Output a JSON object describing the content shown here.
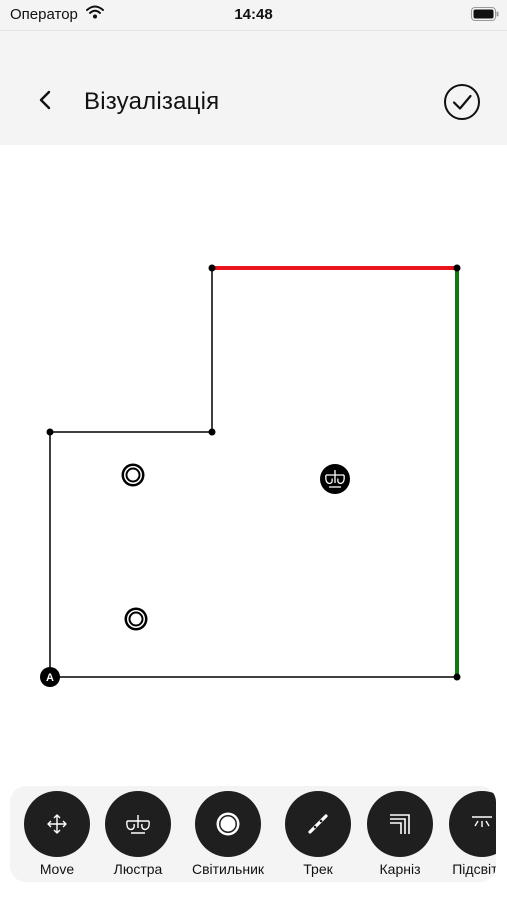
{
  "status_bar": {
    "carrier": "Оператор",
    "time": "14:48"
  },
  "header": {
    "title": "Візуалізація"
  },
  "plan": {
    "corner_label": "A",
    "colors": {
      "wall": "#000000",
      "highlight_top": "#e8131b",
      "highlight_right": "#0f7a0f"
    },
    "fixtures": [
      {
        "type": "spotlight-icon"
      },
      {
        "type": "spotlight-icon"
      },
      {
        "type": "chandelier-icon"
      }
    ]
  },
  "toolbar": {
    "items": [
      {
        "label": "Move",
        "icon": "move-arrows-icon"
      },
      {
        "label": "Люстра",
        "icon": "chandelier-icon"
      },
      {
        "label": "Світильник",
        "icon": "spotlight-icon"
      },
      {
        "label": "Трек",
        "icon": "track-icon"
      },
      {
        "label": "Карніз",
        "icon": "cornice-icon"
      },
      {
        "label": "Підсвітка",
        "icon": "backlight-icon"
      }
    ]
  }
}
